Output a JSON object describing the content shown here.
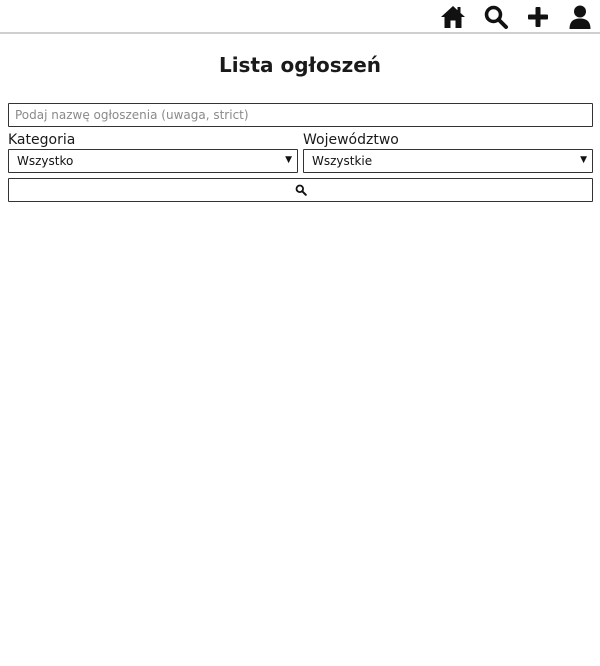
{
  "nav": {
    "icons": [
      "home-icon",
      "search-icon",
      "plus-icon",
      "user-icon"
    ]
  },
  "page": {
    "title": "Lista ogłoszeń"
  },
  "search": {
    "placeholder": "Podaj nazwę ogłoszenia (uwaga, strict)",
    "value": ""
  },
  "filters": {
    "category": {
      "label": "Kategoria",
      "selected": "Wszystko"
    },
    "region": {
      "label": "Województwo",
      "selected": "Wszystkie"
    }
  },
  "colors": {
    "text": "#111111",
    "border": "#333333",
    "divider": "#cfcfcf",
    "placeholder": "#8a8a8a"
  }
}
